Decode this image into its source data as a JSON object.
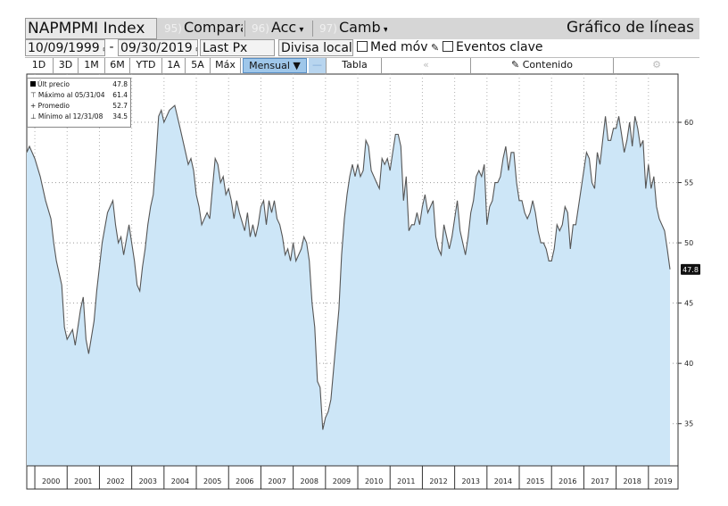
{
  "toolbar": {
    "ticker": "NAPMPMI Index",
    "compare_tag": "95)",
    "compare": "Comparar",
    "acc_tag": "96)",
    "acc": "Acc",
    "camb_tag": "97)",
    "camb": "Camb",
    "title": "Gráfico de líneas",
    "start_date": "10/09/1999",
    "date_sep": "-",
    "end_date": "09/30/2019",
    "field": "Last Px",
    "currency": "Divisa local",
    "moving_avg": "Med móv",
    "key_events": "Eventos clave",
    "ranges": [
      "1D",
      "3D",
      "1M",
      "6M",
      "YTD",
      "1A",
      "5A",
      "Máx"
    ],
    "period": "Mensual",
    "table": "Tabla",
    "content": "Contenido",
    "prev_arrow": "«"
  },
  "legend": {
    "last": {
      "label": "Últ precio",
      "value": "47.8"
    },
    "max": {
      "label": "Máximo al 05/31/04",
      "value": "61.4"
    },
    "avg": {
      "label": "Promedio",
      "value": "52.7"
    },
    "min": {
      "label": "Mínimo al 12/31/08",
      "value": "34.5"
    }
  },
  "chart_data": {
    "type": "area",
    "title": "",
    "xlabel": "",
    "ylabel": "",
    "x_ticks": [
      "2000",
      "2001",
      "2002",
      "2003",
      "2004",
      "2005",
      "2006",
      "2007",
      "2008",
      "2009",
      "2010",
      "2011",
      "2012",
      "2013",
      "2014",
      "2015",
      "2016",
      "2017",
      "2018",
      "2019"
    ],
    "y_ticks": [
      35,
      40,
      45,
      50,
      55,
      60
    ],
    "ylim": [
      31.5,
      64.0
    ],
    "xlim": [
      "1999-10",
      "2019-12"
    ],
    "grid": true,
    "legend_position": "top-left",
    "last_value_label": "47.8",
    "series": [
      {
        "color": "#555555",
        "fill": "#cde6f7",
        "points": [
          [
            "1999-10",
            57.5
          ],
          [
            "1999-11",
            58.0
          ],
          [
            "2000-01",
            57.0
          ],
          [
            "2000-03",
            55.5
          ],
          [
            "2000-05",
            53.5
          ],
          [
            "2000-07",
            52.0
          ],
          [
            "2000-08",
            50.0
          ],
          [
            "2000-09",
            48.5
          ],
          [
            "2000-10",
            47.5
          ],
          [
            "2000-11",
            46.5
          ],
          [
            "2000-12",
            43.0
          ],
          [
            "2001-01",
            42.0
          ],
          [
            "2001-03",
            42.8
          ],
          [
            "2001-04",
            41.5
          ],
          [
            "2001-06",
            44.5
          ],
          [
            "2001-07",
            45.5
          ],
          [
            "2001-08",
            42.0
          ],
          [
            "2001-09",
            40.8
          ],
          [
            "2001-11",
            43.5
          ],
          [
            "2001-12",
            46.0
          ],
          [
            "2002-02",
            50.0
          ],
          [
            "2002-04",
            52.5
          ],
          [
            "2002-06",
            53.5
          ],
          [
            "2002-07",
            51.5
          ],
          [
            "2002-08",
            50.0
          ],
          [
            "2002-09",
            50.5
          ],
          [
            "2002-10",
            49.0
          ],
          [
            "2002-12",
            51.5
          ],
          [
            "2003-01",
            50.0
          ],
          [
            "2003-02",
            48.5
          ],
          [
            "2003-03",
            46.5
          ],
          [
            "2003-04",
            46.0
          ],
          [
            "2003-05",
            48.0
          ],
          [
            "2003-06",
            49.5
          ],
          [
            "2003-07",
            51.5
          ],
          [
            "2003-08",
            53.0
          ],
          [
            "2003-09",
            54.0
          ],
          [
            "2003-10",
            57.0
          ],
          [
            "2003-11",
            60.5
          ],
          [
            "2003-12",
            61.0
          ],
          [
            "2004-01",
            60.0
          ],
          [
            "2004-03",
            61.0
          ],
          [
            "2004-05",
            61.4
          ],
          [
            "2004-07",
            59.5
          ],
          [
            "2004-09",
            57.5
          ],
          [
            "2004-10",
            56.5
          ],
          [
            "2004-11",
            57.0
          ],
          [
            "2004-12",
            56.0
          ],
          [
            "2005-01",
            54.0
          ],
          [
            "2005-02",
            53.0
          ],
          [
            "2005-03",
            51.5
          ],
          [
            "2005-05",
            52.5
          ],
          [
            "2005-06",
            52.0
          ],
          [
            "2005-07",
            54.5
          ],
          [
            "2005-08",
            57.0
          ],
          [
            "2005-09",
            56.5
          ],
          [
            "2005-10",
            55.0
          ],
          [
            "2005-11",
            55.5
          ],
          [
            "2005-12",
            54.0
          ],
          [
            "2006-01",
            54.5
          ],
          [
            "2006-02",
            53.5
          ],
          [
            "2006-03",
            52.0
          ],
          [
            "2006-04",
            53.5
          ],
          [
            "2006-05",
            52.5
          ],
          [
            "2006-07",
            51.0
          ],
          [
            "2006-08",
            52.5
          ],
          [
            "2006-09",
            50.5
          ],
          [
            "2006-10",
            51.5
          ],
          [
            "2006-11",
            50.5
          ],
          [
            "2006-12",
            51.5
          ],
          [
            "2007-01",
            53.0
          ],
          [
            "2007-02",
            53.5
          ],
          [
            "2007-03",
            51.5
          ],
          [
            "2007-04",
            53.5
          ],
          [
            "2007-05",
            52.5
          ],
          [
            "2007-06",
            53.5
          ],
          [
            "2007-07",
            52.0
          ],
          [
            "2007-08",
            51.5
          ],
          [
            "2007-09",
            50.5
          ],
          [
            "2007-10",
            49.0
          ],
          [
            "2007-11",
            49.5
          ],
          [
            "2007-12",
            48.5
          ],
          [
            "2008-01",
            50.0
          ],
          [
            "2008-02",
            48.5
          ],
          [
            "2008-03",
            49.0
          ],
          [
            "2008-04",
            49.5
          ],
          [
            "2008-05",
            50.5
          ],
          [
            "2008-06",
            50.0
          ],
          [
            "2008-07",
            48.5
          ],
          [
            "2008-08",
            45.0
          ],
          [
            "2008-09",
            43.0
          ],
          [
            "2008-10",
            38.5
          ],
          [
            "2008-11",
            38.0
          ],
          [
            "2008-12",
            34.5
          ],
          [
            "2009-01",
            35.5
          ],
          [
            "2009-02",
            36.0
          ],
          [
            "2009-03",
            37.0
          ],
          [
            "2009-04",
            39.5
          ],
          [
            "2009-05",
            42.0
          ],
          [
            "2009-06",
            44.5
          ],
          [
            "2009-07",
            49.0
          ],
          [
            "2009-08",
            52.0
          ],
          [
            "2009-09",
            54.0
          ],
          [
            "2009-10",
            55.5
          ],
          [
            "2009-11",
            56.5
          ],
          [
            "2009-12",
            55.5
          ],
          [
            "2010-01",
            56.5
          ],
          [
            "2010-02",
            55.5
          ],
          [
            "2010-03",
            56.0
          ],
          [
            "2010-04",
            58.5
          ],
          [
            "2010-05",
            58.0
          ],
          [
            "2010-06",
            56.0
          ],
          [
            "2010-07",
            55.5
          ],
          [
            "2010-08",
            55.0
          ],
          [
            "2010-09",
            54.5
          ],
          [
            "2010-10",
            57.0
          ],
          [
            "2010-11",
            56.5
          ],
          [
            "2010-12",
            57.0
          ],
          [
            "2011-01",
            56.0
          ],
          [
            "2011-02",
            57.5
          ],
          [
            "2011-03",
            59.0
          ],
          [
            "2011-04",
            59.0
          ],
          [
            "2011-05",
            58.0
          ],
          [
            "2011-06",
            53.5
          ],
          [
            "2011-07",
            55.5
          ],
          [
            "2011-08",
            51.0
          ],
          [
            "2011-09",
            51.5
          ],
          [
            "2011-10",
            51.5
          ],
          [
            "2011-11",
            52.5
          ],
          [
            "2011-12",
            51.5
          ],
          [
            "2012-01",
            53.0
          ],
          [
            "2012-02",
            54.0
          ],
          [
            "2012-03",
            52.5
          ],
          [
            "2012-04",
            53.0
          ],
          [
            "2012-05",
            53.5
          ],
          [
            "2012-06",
            50.5
          ],
          [
            "2012-07",
            49.5
          ],
          [
            "2012-08",
            49.0
          ],
          [
            "2012-09",
            51.5
          ],
          [
            "2012-10",
            50.5
          ],
          [
            "2012-11",
            49.5
          ],
          [
            "2012-12",
            50.5
          ],
          [
            "2013-01",
            52.0
          ],
          [
            "2013-02",
            53.5
          ],
          [
            "2013-03",
            51.0
          ],
          [
            "2013-04",
            50.0
          ],
          [
            "2013-05",
            49.0
          ],
          [
            "2013-06",
            50.5
          ],
          [
            "2013-07",
            52.5
          ],
          [
            "2013-08",
            53.5
          ],
          [
            "2013-09",
            55.5
          ],
          [
            "2013-10",
            56.0
          ],
          [
            "2013-11",
            55.5
          ],
          [
            "2013-12",
            56.5
          ],
          [
            "2014-01",
            51.5
          ],
          [
            "2014-02",
            53.0
          ],
          [
            "2014-03",
            53.5
          ],
          [
            "2014-04",
            55.0
          ],
          [
            "2014-05",
            55.0
          ],
          [
            "2014-06",
            55.5
          ],
          [
            "2014-07",
            57.0
          ],
          [
            "2014-08",
            58.0
          ],
          [
            "2014-09",
            56.0
          ],
          [
            "2014-10",
            57.5
          ],
          [
            "2014-11",
            57.5
          ],
          [
            "2014-12",
            55.0
          ],
          [
            "2015-01",
            53.5
          ],
          [
            "2015-02",
            53.5
          ],
          [
            "2015-03",
            52.5
          ],
          [
            "2015-04",
            52.0
          ],
          [
            "2015-05",
            52.5
          ],
          [
            "2015-06",
            53.5
          ],
          [
            "2015-07",
            52.5
          ],
          [
            "2015-08",
            51.0
          ],
          [
            "2015-09",
            50.0
          ],
          [
            "2015-10",
            50.0
          ],
          [
            "2015-11",
            49.5
          ],
          [
            "2015-12",
            48.5
          ],
          [
            "2016-01",
            48.5
          ],
          [
            "2016-02",
            49.5
          ],
          [
            "2016-03",
            51.5
          ],
          [
            "2016-04",
            51.0
          ],
          [
            "2016-05",
            51.5
          ],
          [
            "2016-06",
            53.0
          ],
          [
            "2016-07",
            52.5
          ],
          [
            "2016-08",
            49.5
          ],
          [
            "2016-09",
            51.5
          ],
          [
            "2016-10",
            51.5
          ],
          [
            "2016-11",
            53.0
          ],
          [
            "2016-12",
            54.5
          ],
          [
            "2017-01",
            56.0
          ],
          [
            "2017-02",
            57.5
          ],
          [
            "2017-03",
            57.0
          ],
          [
            "2017-04",
            55.0
          ],
          [
            "2017-05",
            54.5
          ],
          [
            "2017-06",
            57.5
          ],
          [
            "2017-07",
            56.5
          ],
          [
            "2017-08",
            58.5
          ],
          [
            "2017-09",
            60.5
          ],
          [
            "2017-10",
            58.5
          ],
          [
            "2017-11",
            58.5
          ],
          [
            "2017-12",
            59.5
          ],
          [
            "2018-01",
            59.5
          ],
          [
            "2018-02",
            60.5
          ],
          [
            "2018-03",
            59.0
          ],
          [
            "2018-04",
            57.5
          ],
          [
            "2018-05",
            58.5
          ],
          [
            "2018-06",
            60.0
          ],
          [
            "2018-07",
            58.0
          ],
          [
            "2018-08",
            60.5
          ],
          [
            "2018-09",
            59.5
          ],
          [
            "2018-10",
            58.0
          ],
          [
            "2018-11",
            58.5
          ],
          [
            "2018-12",
            54.5
          ],
          [
            "2019-01",
            56.5
          ],
          [
            "2019-02",
            54.5
          ],
          [
            "2019-03",
            55.5
          ],
          [
            "2019-04",
            53.0
          ],
          [
            "2019-05",
            52.0
          ],
          [
            "2019-06",
            51.5
          ],
          [
            "2019-07",
            51.0
          ],
          [
            "2019-08",
            49.5
          ],
          [
            "2019-09",
            47.8
          ]
        ]
      }
    ]
  }
}
